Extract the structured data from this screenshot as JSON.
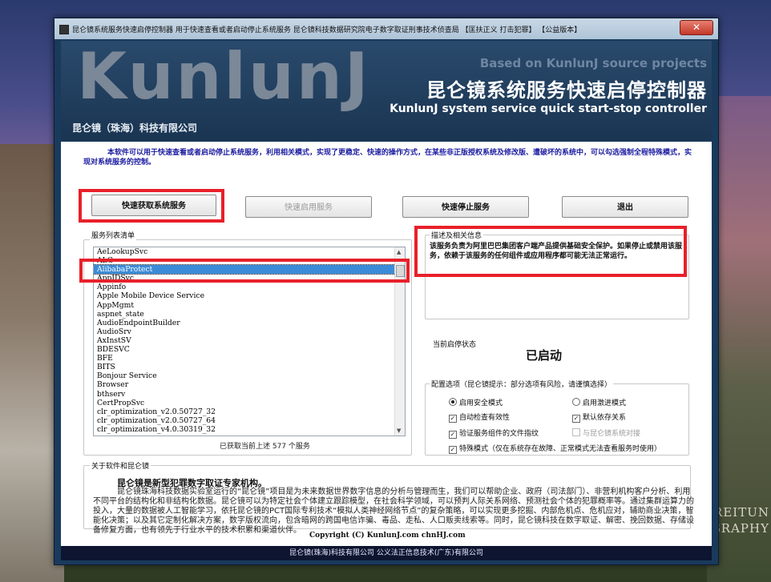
{
  "window": {
    "title": "昆仑镜系统服务快速启停控制器   用于快速查看或者启动停止系统服务  昆仑镜科技数据研究院电子数字取证刑事技术侦查局    【匡扶正义 打击犯罪】 【公益版本】",
    "close_label": "✕"
  },
  "background": {
    "watermark_line1": "BREITUN",
    "watermark_line2": "OGRAPHY"
  },
  "banner": {
    "logo": "KunlunJ",
    "company": "昆仑镜（珠海）科技有限公司",
    "based_on": "Based on KunlunJ source projects",
    "title_cn": "昆仑镜系统服务快速启停控制器",
    "title_en": "KunlunJ system service quick start-stop controller"
  },
  "intro": "本软件可以用于快速查看或者启动停止系统服务，利用相关模式，实现了更稳定、快速的操作方式，在某些非正版授权系统及修改版、遭破坏的系统中，可以勾选强制全程特殊模式，实现对系统服务的控制。",
  "buttons": {
    "fetch": "快速获取系统服务",
    "start": "快速启用服务",
    "stop": "快速停止服务",
    "exit": "退出"
  },
  "service_list": {
    "label": "服务列表清单",
    "items": [
      "AeLookupSvc",
      "ALG",
      "AlibabaProtect",
      "AppIDSvc",
      "Appinfo",
      "Apple Mobile Device Service",
      "AppMgmt",
      "aspnet_state",
      "AudioEndpointBuilder",
      "AudioSrv",
      "AxInstSV",
      "BDESVC",
      "BFE",
      "BITS",
      "Bonjour Service",
      "Browser",
      "bthserv",
      "CertPropSvc",
      "clr_optimization_v2.0.50727_32",
      "clr_optimization_v2.0.50727_64",
      "clr_optimization_v4.0.30319_32"
    ],
    "selected_index": 2,
    "count_text": "已获取当前上述 577 个服务"
  },
  "description": {
    "label": "描述及相关信息",
    "text": "该服务负责为阿里巴巴集团客户端产品提供基础安全保护。如果停止或禁用该服务，依赖于该服务的任何组件或应用程序都可能无法正常运行。"
  },
  "status": {
    "label": "当前启停状态",
    "value": "已启动"
  },
  "options": {
    "label": "配置选项（昆仑镜提示：部分选项有风险，请谨慎选择）",
    "safe_mode": "启用安全模式",
    "aggressive_mode": "启用激进模式",
    "auto_check": "自动检查有效性",
    "default_deps": "默认依存关系",
    "verify_fingerprint": "验证服务组件的文件指纹",
    "kunlunj_link": "与昆仑镜系统对接",
    "special_mode": "特殊模式（仅在系统存在故障、正常模式无法查看服务时使用）"
  },
  "about": {
    "label": "关于软件和昆仑镜",
    "headline": "昆仑镜是新型犯罪数字取证专家机构。",
    "body": "昆仑镜珠海科技数据实验室运行的“昆仑镜”项目是为未来数据世界数字信息的分析与管理而生，我们可以帮助企业、政府（司法部门）、非营利机构客户分析、利用不同平台的结构化和非结构化数据。昆仑镜可以为特定社会个体建立跟踪模型，在社会科学领域，可以预判人际关系网络、预测社会个体的犯罪概率等。通过集群运算力的投入，大量的数据被人工智能学习，依托昆仑镜的PCT国际专利技术“模拟人类神经网络节点”的复杂策略，可以实现更多挖掘、内部危机点、危机应对，辅助商业决策，智能化决策；以及其它定制化解决方案，数字版权流向，包含暗网的跨国电信诈骗、毒品、走私、人口贩卖线索等。同时，昆仑镜科技在数字取证、解密、挽回数据、存储设备修复方面，也有领先于行业水平的技术积累和渠道伙伴。"
  },
  "copyright": "Copyright (C) KunlunJ.com   chnHJ.com",
  "footer": "昆仑镜(珠海)科技有限公司 公义法正信息技术(广东)有限公司"
}
